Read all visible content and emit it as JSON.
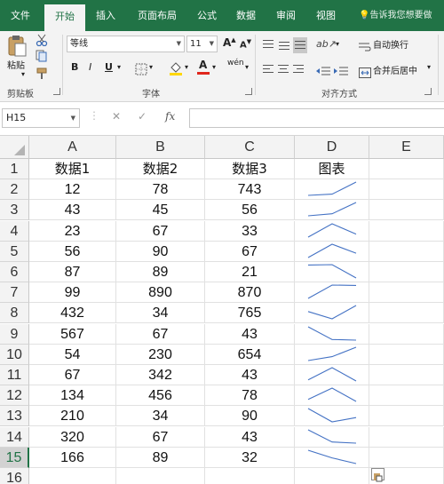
{
  "ribbon": {
    "tabs": [
      "文件",
      "开始",
      "插入",
      "页面布局",
      "公式",
      "数据",
      "审阅",
      "视图"
    ],
    "tell_me": "告诉我您想要做",
    "clipboard": {
      "paste": "粘贴",
      "group": "剪贴板"
    },
    "font": {
      "name": "等线",
      "size": "11",
      "bold": "B",
      "italic": "I",
      "underline": "U",
      "font_color_mark": "A",
      "grow": "A",
      "shrink": "A",
      "wen": "wén",
      "group": "字体"
    },
    "alignment": {
      "wrap": "自动换行",
      "merge": "合并后居中",
      "group": "对齐方式"
    }
  },
  "formula_bar": {
    "name_box": "H15",
    "fx": "fx",
    "formula": ""
  },
  "sheet": {
    "columns": [
      "A",
      "B",
      "C",
      "D",
      "E"
    ],
    "rows": [
      "1",
      "2",
      "3",
      "4",
      "5",
      "6",
      "7",
      "8",
      "9",
      "10",
      "11",
      "12",
      "13",
      "14",
      "15",
      "16"
    ],
    "headers": [
      "数据1",
      "数据2",
      "数据3",
      "图表"
    ],
    "data": [
      [
        "12",
        "78",
        "743"
      ],
      [
        "43",
        "45",
        "56"
      ],
      [
        "23",
        "67",
        "33"
      ],
      [
        "56",
        "90",
        "67"
      ],
      [
        "87",
        "89",
        "21"
      ],
      [
        "99",
        "890",
        "870"
      ],
      [
        "432",
        "34",
        "765"
      ],
      [
        "567",
        "67",
        "43"
      ],
      [
        "54",
        "230",
        "654"
      ],
      [
        "67",
        "342",
        "43"
      ],
      [
        "134",
        "456",
        "78"
      ],
      [
        "210",
        "34",
        "90"
      ],
      [
        "320",
        "67",
        "43"
      ],
      [
        "166",
        "89",
        "32"
      ]
    ],
    "selected_row": "15"
  },
  "colors": {
    "excel_green": "#217346",
    "sparkline": "#4472c4",
    "font_color": "#e0261c",
    "highlight": "#ffd700"
  }
}
